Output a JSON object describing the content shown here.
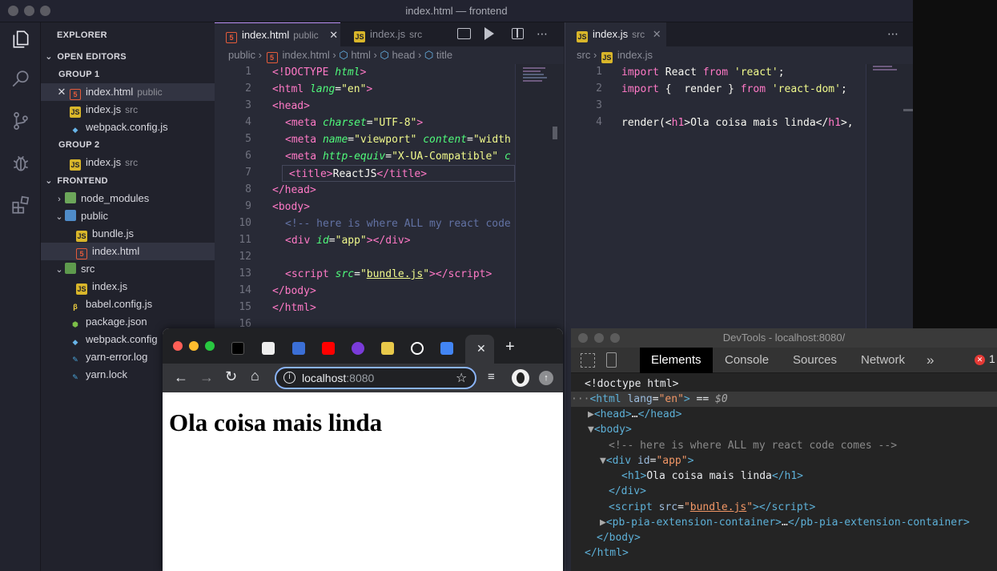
{
  "vscode": {
    "window_title": "index.html — frontend",
    "explorer": {
      "title": "EXPLORER",
      "open_editors_title": "OPEN EDITORS",
      "group1_title": "GROUP 1",
      "group1_items": [
        {
          "name": "index.html",
          "sub": "public"
        },
        {
          "name": "index.js",
          "sub": "src"
        },
        {
          "name": "webpack.config.js",
          "sub": ""
        }
      ],
      "group2_title": "GROUP 2",
      "group2_items": [
        {
          "name": "index.js",
          "sub": "src"
        }
      ],
      "project_title": "FRONTEND",
      "tree": [
        {
          "name": "node_modules"
        },
        {
          "name": "public"
        },
        {
          "name": "bundle.js"
        },
        {
          "name": "index.html"
        },
        {
          "name": "src"
        },
        {
          "name": "index.js"
        },
        {
          "name": "babel.config.js"
        },
        {
          "name": "package.json"
        },
        {
          "name": "webpack.config"
        },
        {
          "name": "yarn-error.log"
        },
        {
          "name": "yarn.lock"
        }
      ]
    },
    "editor1": {
      "tabs": [
        {
          "name": "index.html",
          "sub": "public"
        },
        {
          "name": "index.js",
          "sub": "src"
        }
      ],
      "breadcrumbs": [
        "public",
        "index.html",
        "html",
        "head",
        "title"
      ],
      "line_numbers": [
        "1",
        "2",
        "3",
        "4",
        "5",
        "6",
        "7",
        "8",
        "9",
        "10",
        "11",
        "12",
        "13",
        "14",
        "15",
        "16"
      ]
    },
    "editor2": {
      "tab": {
        "name": "index.js",
        "sub": "src"
      },
      "breadcrumbs": [
        "src",
        "index.js"
      ],
      "line_numbers": [
        "1",
        "2",
        "3",
        "4"
      ]
    }
  },
  "chrome": {
    "url_host": "localhost",
    "url_port": ":8080",
    "page_heading": "Ola coisa mais linda"
  },
  "devtools": {
    "title": "DevTools - localhost:8080/",
    "tabs": [
      "Elements",
      "Console",
      "Sources",
      "Network"
    ],
    "error_count": "1"
  },
  "colors": {
    "accent": "#bd93f9",
    "editor_bg": "#282a36",
    "sidebar_bg": "#21222c",
    "devtools_tab_active": "#000000"
  }
}
